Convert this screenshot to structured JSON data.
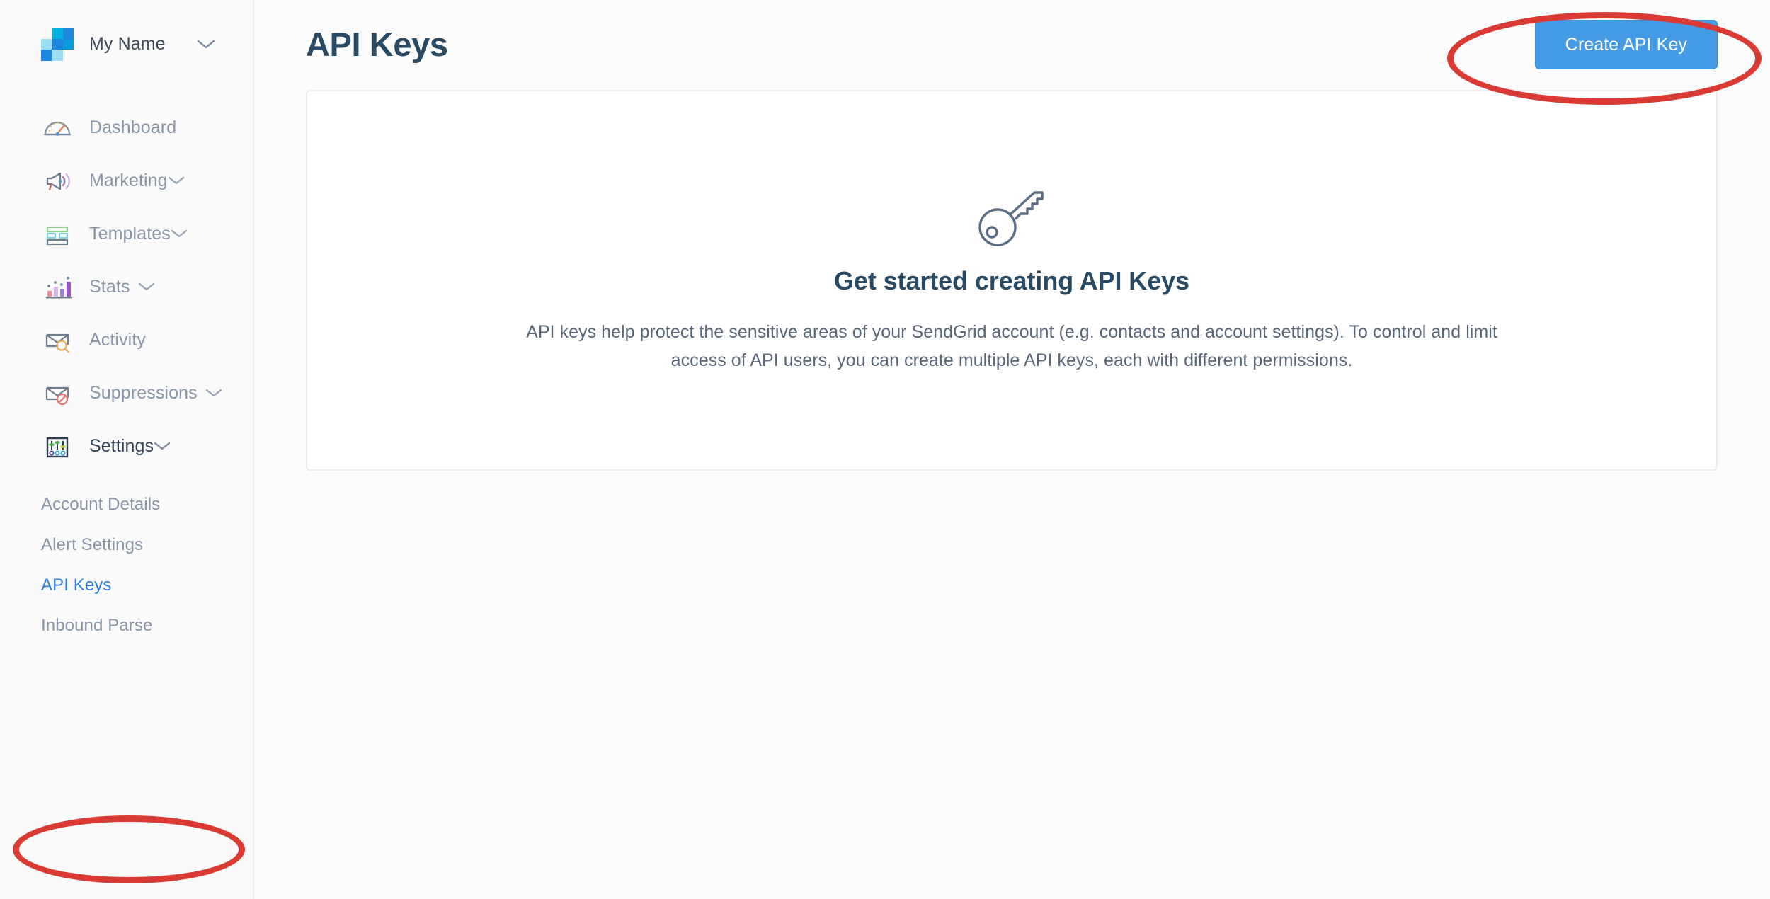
{
  "brand": {
    "name": "My Name",
    "logo_name": "sendgrid-logo",
    "caret_icon": "chevron-down-icon",
    "logo_colors": {
      "light_blue": "#9bdcf3",
      "cyan": "#06b0e0",
      "blue": "#1f87e0",
      "mid_blue": "#0a9bdb"
    }
  },
  "sidebar": {
    "items": [
      {
        "label": "Dashboard",
        "icon": "gauge-icon",
        "expandable": false
      },
      {
        "label": "Marketing",
        "icon": "megaphone-icon",
        "expandable": true
      },
      {
        "label": "Templates",
        "icon": "templates-icon",
        "expandable": true
      },
      {
        "label": "Stats",
        "icon": "bar-chart-icon",
        "expandable": true
      },
      {
        "label": "Activity",
        "icon": "envelope-search-icon",
        "expandable": false
      },
      {
        "label": "Suppressions",
        "icon": "envelope-blocked-icon",
        "expandable": true
      },
      {
        "label": "Settings",
        "icon": "sliders-icon",
        "expandable": true,
        "active": true
      }
    ],
    "subitems": [
      {
        "label": "Account Details",
        "selected": false
      },
      {
        "label": "Alert Settings",
        "selected": false
      },
      {
        "label": "API Keys",
        "selected": true
      },
      {
        "label": "Inbound Parse",
        "selected": false
      }
    ],
    "caret_icon": "chevron-down-icon"
  },
  "header": {
    "title": "API Keys",
    "create_button": "Create API Key",
    "create_button_color": "#459ae5"
  },
  "empty_state": {
    "icon": "key-icon",
    "title": "Get started creating API Keys",
    "body": "API keys help protect the sensitive areas of your SendGrid account (e.g. contacts and account settings). To control and limit access of API users, you can create multiple API keys, each with different permissions."
  },
  "annotations": {
    "color": "#d93b34",
    "items": [
      {
        "name": "create-api-key-highlight",
        "shape": "ellipse",
        "target": "Create API Key"
      },
      {
        "name": "api-keys-nav-highlight",
        "shape": "ellipse",
        "target": "API Keys"
      }
    ]
  }
}
